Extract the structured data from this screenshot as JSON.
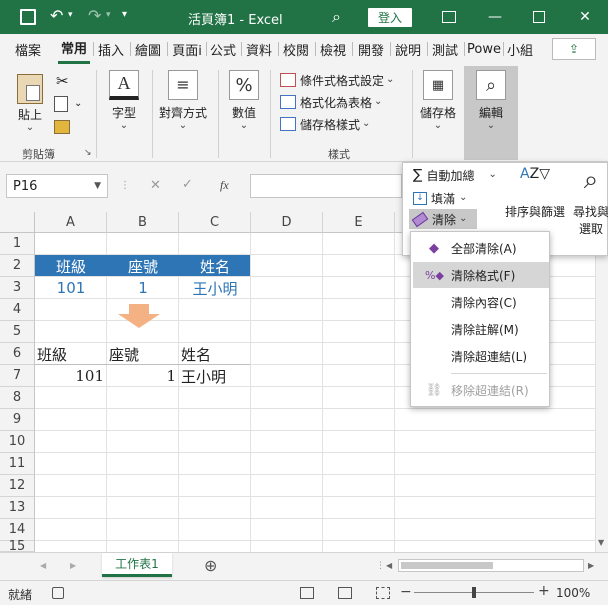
{
  "titlebar": {
    "save_icon": "save-icon",
    "undo_icon": "undo-icon",
    "redo_icon": "redo-icon",
    "doc_title": "活頁簿1 - Excel",
    "search_icon": "search-icon",
    "login_label": "登入",
    "colors": {
      "bar": "#217346"
    }
  },
  "tabs": [
    {
      "label": "檔案"
    },
    {
      "label": "常用"
    },
    {
      "label": "插入"
    },
    {
      "label": "繪圖"
    },
    {
      "label": "頁面i"
    },
    {
      "label": "公式"
    },
    {
      "label": "資料"
    },
    {
      "label": "校閱"
    },
    {
      "label": "檢視"
    },
    {
      "label": "開發"
    },
    {
      "label": "說明"
    },
    {
      "label": "測試"
    },
    {
      "label": "Powe"
    },
    {
      "label": "小組"
    }
  ],
  "ribbon": {
    "paste_label": "貼上",
    "clipboard_group": "剪貼簿",
    "font_label": "字型",
    "align_label": "對齊方式",
    "number_label": "數值",
    "style_items": [
      "條件式格式設定",
      "格式化為表格",
      "儲存格樣式"
    ],
    "styles_group": "樣式",
    "cells_label": "儲存格",
    "editing_label": "編輯"
  },
  "formula_bar": {
    "name_box": "P16",
    "fx": "fx"
  },
  "grid": {
    "columns": [
      "A",
      "B",
      "C",
      "D",
      "E"
    ],
    "rows": [
      "1",
      "2",
      "3",
      "4",
      "5",
      "6",
      "7",
      "8",
      "9",
      "10",
      "11",
      "12",
      "13",
      "14",
      "15"
    ],
    "header_row": [
      "班級",
      "座號",
      "姓名"
    ],
    "data_row": [
      "101",
      "1",
      "王小明"
    ],
    "table_header_row": [
      "班級",
      "座號",
      "姓名"
    ],
    "table_data_row": [
      "101",
      "1",
      "王小明"
    ],
    "colors": {
      "header_bg": "#2e75b6",
      "data_text": "#2e75b6",
      "arrow": "#f4b183"
    }
  },
  "editing_panel": {
    "autosum": "自動加總",
    "fill": "填滿",
    "clear": "清除",
    "sort_filter": "排序與篩選",
    "find_select_line1": "尋找與",
    "find_select_line2": "選取"
  },
  "clear_menu": [
    {
      "label": "全部清除(A)",
      "icon": "eraser-icon",
      "state": "normal"
    },
    {
      "label": "清除格式(F)",
      "icon": "clear-format-icon",
      "state": "hover"
    },
    {
      "label": "清除內容(C)",
      "icon": "",
      "state": "normal"
    },
    {
      "label": "清除註解(M)",
      "icon": "",
      "state": "normal"
    },
    {
      "label": "清除超連結(L)",
      "icon": "",
      "state": "normal"
    },
    {
      "label": "移除超連結(R)",
      "icon": "remove-link-icon",
      "state": "disabled"
    }
  ],
  "sheet_tabs": {
    "active": "工作表1",
    "add": "⊕"
  },
  "status": {
    "ready": "就緒",
    "zoom": "100%"
  }
}
